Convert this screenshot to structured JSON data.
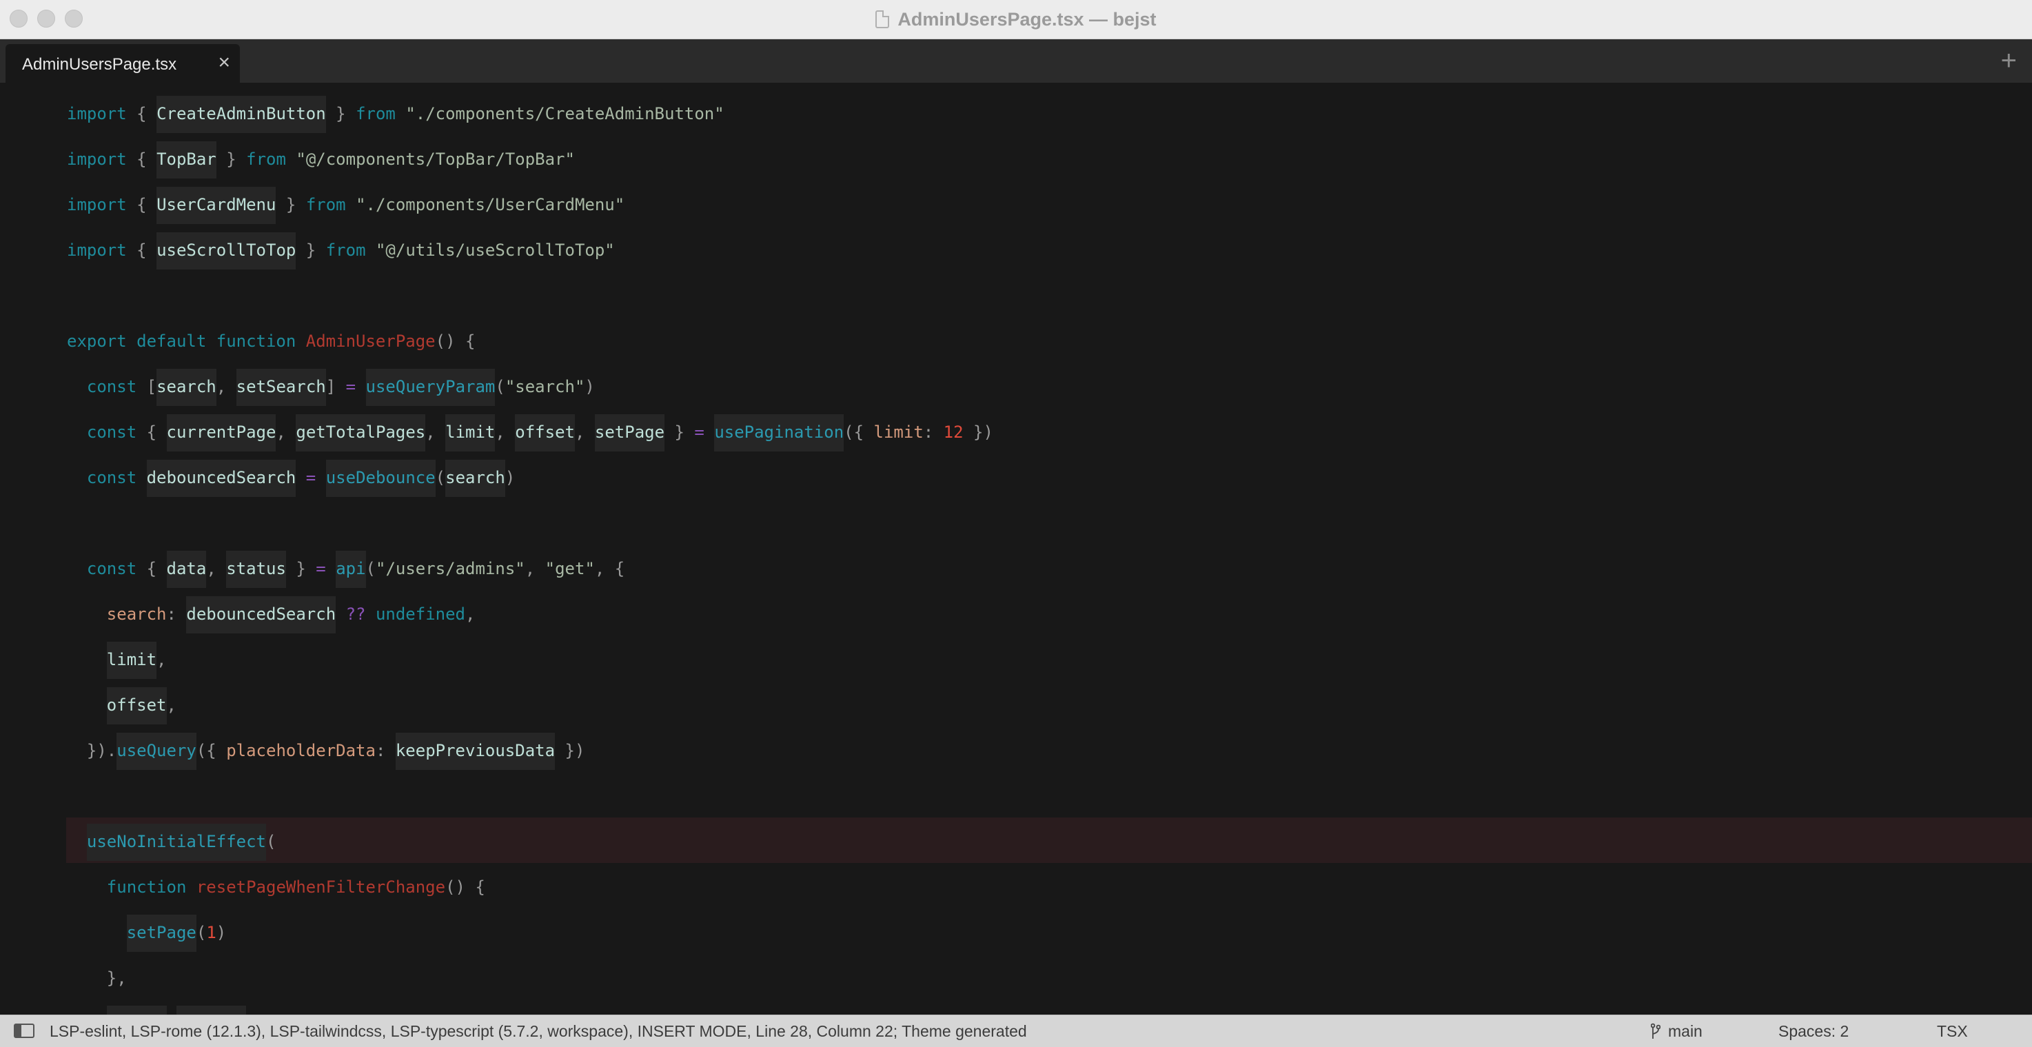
{
  "window": {
    "title": "AdminUsersPage.tsx — bejst"
  },
  "tabs": [
    {
      "label": "AdminUsersPage.tsx",
      "close": "×"
    }
  ],
  "tab_add": "+",
  "editor": {
    "lines": [
      [
        [
          "kw",
          "import "
        ],
        [
          "pun",
          "{ "
        ],
        [
          "ident ref",
          "CreateAdminButton"
        ],
        [
          "pun",
          " } "
        ],
        [
          "kw",
          "from "
        ],
        [
          "str",
          "\"./components/CreateAdminButton\""
        ]
      ],
      [
        [
          "kw",
          "import "
        ],
        [
          "pun",
          "{ "
        ],
        [
          "ident ref",
          "TopBar"
        ],
        [
          "pun",
          " } "
        ],
        [
          "kw",
          "from "
        ],
        [
          "str",
          "\"@/components/TopBar/TopBar\""
        ]
      ],
      [
        [
          "kw",
          "import "
        ],
        [
          "pun",
          "{ "
        ],
        [
          "ident ref",
          "UserCardMenu"
        ],
        [
          "pun",
          " } "
        ],
        [
          "kw",
          "from "
        ],
        [
          "str",
          "\"./components/UserCardMenu\""
        ]
      ],
      [
        [
          "kw",
          "import "
        ],
        [
          "pun",
          "{ "
        ],
        [
          "ident ref",
          "useScrollToTop"
        ],
        [
          "pun",
          " } "
        ],
        [
          "kw",
          "from "
        ],
        [
          "str",
          "\"@/utils/useScrollToTop\""
        ]
      ],
      [],
      [
        [
          "kw",
          "export default function "
        ],
        [
          "fn",
          "AdminUserPage"
        ],
        [
          "pun",
          "() {"
        ]
      ],
      [
        [
          "pun",
          "  "
        ],
        [
          "kw",
          "const "
        ],
        [
          "pun",
          "["
        ],
        [
          "ident ref",
          "search"
        ],
        [
          "pun",
          ", "
        ],
        [
          "ident ref",
          "setSearch"
        ],
        [
          "pun",
          "] "
        ],
        [
          "op",
          "= "
        ],
        [
          "call ref",
          "useQueryParam"
        ],
        [
          "pun",
          "("
        ],
        [
          "str",
          "\"search\""
        ],
        [
          "pun",
          ")"
        ]
      ],
      [
        [
          "pun",
          "  "
        ],
        [
          "kw",
          "const "
        ],
        [
          "pun",
          "{ "
        ],
        [
          "ident ref",
          "currentPage"
        ],
        [
          "pun",
          ", "
        ],
        [
          "ident ref",
          "getTotalPages"
        ],
        [
          "pun",
          ", "
        ],
        [
          "ident ref",
          "limit"
        ],
        [
          "pun",
          ", "
        ],
        [
          "ident ref",
          "offset"
        ],
        [
          "pun",
          ", "
        ],
        [
          "ident ref",
          "setPage"
        ],
        [
          "pun",
          " } "
        ],
        [
          "op",
          "= "
        ],
        [
          "call ref",
          "usePagination"
        ],
        [
          "pun",
          "({ "
        ],
        [
          "prop",
          "limit"
        ],
        [
          "pun",
          ": "
        ],
        [
          "num",
          "12"
        ],
        [
          "pun",
          " })"
        ]
      ],
      [
        [
          "pun",
          "  "
        ],
        [
          "kw",
          "const "
        ],
        [
          "ident ref",
          "debouncedSearch"
        ],
        [
          "op",
          " = "
        ],
        [
          "call ref",
          "useDebounce"
        ],
        [
          "pun",
          "("
        ],
        [
          "ident ref",
          "search"
        ],
        [
          "pun",
          ")"
        ]
      ],
      [],
      [
        [
          "pun",
          "  "
        ],
        [
          "kw",
          "const "
        ],
        [
          "pun",
          "{ "
        ],
        [
          "ident ref",
          "data"
        ],
        [
          "pun",
          ", "
        ],
        [
          "ident ref",
          "status"
        ],
        [
          "pun",
          " } "
        ],
        [
          "op",
          "= "
        ],
        [
          "call ref",
          "api"
        ],
        [
          "pun",
          "("
        ],
        [
          "str",
          "\"/users/admins\""
        ],
        [
          "pun",
          ", "
        ],
        [
          "str",
          "\"get\""
        ],
        [
          "pun",
          ", {"
        ]
      ],
      [
        [
          "pun",
          "    "
        ],
        [
          "prop",
          "search"
        ],
        [
          "pun",
          ": "
        ],
        [
          "ident ref",
          "debouncedSearch"
        ],
        [
          "op",
          " ?? "
        ],
        [
          "kw",
          "undefined"
        ],
        [
          "pun",
          ","
        ]
      ],
      [
        [
          "pun",
          "    "
        ],
        [
          "ident ref",
          "limit"
        ],
        [
          "pun",
          ","
        ]
      ],
      [
        [
          "pun",
          "    "
        ],
        [
          "ident ref",
          "offset"
        ],
        [
          "pun",
          ","
        ]
      ],
      [
        [
          "pun",
          "  })."
        ],
        [
          "call ref",
          "useQuery"
        ],
        [
          "pun",
          "({ "
        ],
        [
          "prop",
          "placeholderData"
        ],
        [
          "pun",
          ": "
        ],
        [
          "ident ref",
          "keepPreviousData"
        ],
        [
          "pun",
          " })"
        ]
      ],
      [],
      [
        [
          "pun",
          "  "
        ],
        [
          "call ref",
          "useNoInitialEffect"
        ],
        [
          "pun",
          "("
        ]
      ],
      [
        [
          "pun",
          "    "
        ],
        [
          "kw",
          "function "
        ],
        [
          "fn",
          "resetPageWhenFilterChange"
        ],
        [
          "pun",
          "() {"
        ]
      ],
      [
        [
          "pun",
          "      "
        ],
        [
          "call ref",
          "setPage"
        ],
        [
          "pun",
          "("
        ],
        [
          "num",
          "1"
        ],
        [
          "pun",
          ")"
        ]
      ],
      [
        [
          "pun",
          "    },"
        ]
      ],
      [
        [
          "pun",
          "    "
        ],
        [
          "ident ref",
          "      "
        ],
        [
          "pun",
          " "
        ],
        [
          "ident ref",
          "       "
        ]
      ]
    ]
  },
  "status_bar": {
    "text": "LSP-eslint, LSP-rome (12.1.3), LSP-tailwindcss, LSP-typescript (5.7.2, workspace), INSERT MODE, Line 28, Column 22; Theme generated",
    "branch": "main",
    "spaces": "Spaces: 2",
    "syntax": "TSX"
  }
}
